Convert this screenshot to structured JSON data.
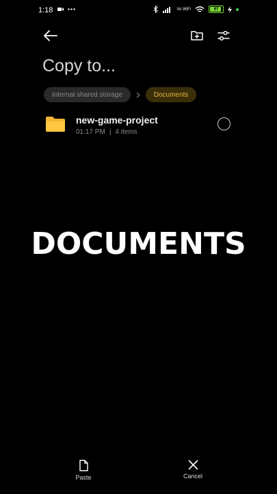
{
  "status_bar": {
    "time": "1:18",
    "network_label": "Vo WiFi",
    "battery": "97",
    "icons": [
      "video-icon",
      "more-icon",
      "bluetooth-icon",
      "signal-icon",
      "wifi-icon",
      "battery-icon",
      "charging-icon"
    ]
  },
  "toolbar": {
    "back_icon": "arrow-left-icon",
    "new_folder_icon": "folder-plus-icon",
    "filter_icon": "sliders-icon"
  },
  "page": {
    "title": "Copy to..."
  },
  "breadcrumb": {
    "items": [
      "Internal shared storage",
      "Documents"
    ]
  },
  "files": [
    {
      "name": "new-game-project",
      "time": "01:17 PM",
      "separator": "|",
      "count": "4 items"
    }
  ],
  "overlay": {
    "text": "DOCUMENTS"
  },
  "bottom_actions": {
    "paste_label": "Paste",
    "cancel_label": "Cancel"
  },
  "colors": {
    "background": "#000000",
    "accent": "#e3b53c",
    "battery": "#7ddc3a"
  }
}
